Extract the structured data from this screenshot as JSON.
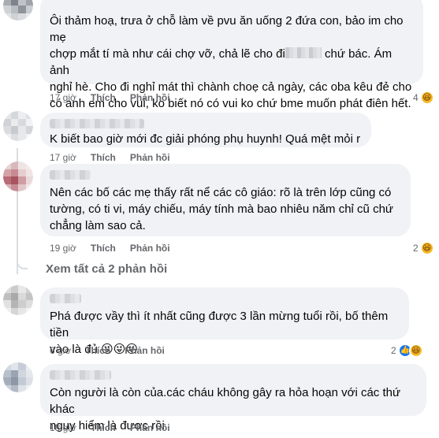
{
  "comments": [
    {
      "lines": [
        "Ôi thảm hoạ, trưa ở chỗ làm về pvu ăn uống 2 đứa con, bảo im cho mẹ",
        "chợp mắt tí mà như cái chợ vỡ, chả lẽ cho đi",
        "chứ bác. Ám ảnh",
        "nghỉ hè. Cho đi nghỉ mát thì chành choẹ cả ngày, các oba kêu đẻ cho",
        "có anh em cho vui, ko biết nó có vui ko chứ bme muốn phát điên hết."
      ],
      "time": "17 giờ",
      "like": "Thích",
      "reply": "Phản hồi",
      "reaction_count": "4"
    },
    {
      "lines": [
        "K biết bao giờ mới đc giải phóng phụ huynh! Quá mệt mỏi r"
      ],
      "time": "17 giờ",
      "like": "Thích",
      "reply": "Phản hồi"
    },
    {
      "lines": [
        "Nên các bố các mẹ thấy rất nể các cô giáo: rõ là trên lớp cũng có",
        "tường, có ti vi, máy chiếu, máy tính mà bao nhiêu năm chỉ cũ chứ",
        "chẳng làm sao cả."
      ],
      "time": "19 giờ",
      "like": "Thích",
      "reply": "Phản hồi",
      "reaction_count": "2"
    },
    {
      "lines": [
        "Phá được vầy thì ít nhất cũng được 3 lần mừng tuổi rồi, bố thêm tiền",
        "vào là đủ"
      ],
      "time": "6 giờ",
      "like": "Thích",
      "reply": "Phản hồi",
      "reaction_count": "2"
    },
    {
      "lines": [
        "Còn người là còn của.các cháu không gây ra hỏa hoạn với các thứ khác",
        "nguy hiểm là được rồi."
      ],
      "time": "18 giờ",
      "like": "Thích",
      "reply": "Phản hồi"
    }
  ],
  "view_replies": "Xem tất cả 2 phản hồi",
  "icons": {
    "haha": "haha-reaction-icon",
    "like": "like-reaction-icon"
  },
  "colors": {
    "bubble": "#f0f2f5",
    "meta": "#65676b",
    "like_blue": "#1877f2",
    "haha_yellow": "#f7b928"
  }
}
